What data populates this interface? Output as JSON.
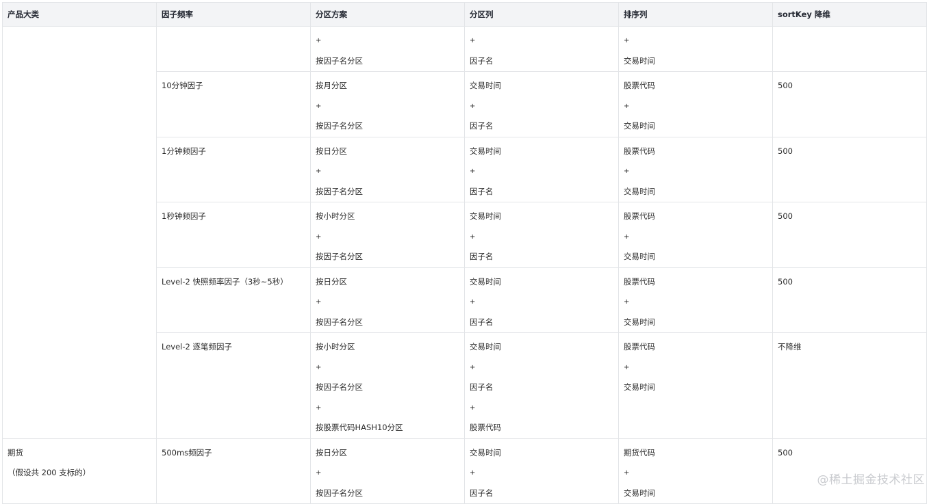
{
  "headers": [
    "产品大类",
    "因子频率",
    "分区方案",
    "分区列",
    "排序列",
    "sortKey 降维"
  ],
  "top_partial_row": {
    "scheme": [
      "+",
      "按因子名分区"
    ],
    "partcol": [
      "+",
      "因子名"
    ],
    "sortcol": [
      "+",
      "交易时间"
    ],
    "sortkey": ""
  },
  "rows": [
    {
      "freq": "10分钟因子",
      "scheme": [
        "按月分区",
        "+",
        " 按因子名分区"
      ],
      "partcol": [
        "交易时间",
        "+",
        " 因子名"
      ],
      "sortcol": [
        "股票代码",
        "+",
        "交易时间"
      ],
      "sortkey": "500"
    },
    {
      "freq": "1分钟频因子",
      "scheme": [
        "按日分区",
        "+",
        "按因子名分区"
      ],
      "partcol": [
        "交易时间",
        "+",
        " 因子名"
      ],
      "sortcol": [
        "股票代码",
        "+",
        "交易时间"
      ],
      "sortkey": "500"
    },
    {
      "freq": "1秒钟频因子",
      "scheme": [
        "按小时分区",
        "+",
        "按因子名分区"
      ],
      "partcol": [
        "交易时间",
        "+",
        "因子名"
      ],
      "sortcol": [
        "股票代码",
        "+",
        "交易时间"
      ],
      "sortkey": "500"
    },
    {
      "freq": "Level-2 快照频率因子（3秒~5秒）",
      "scheme": [
        "按日分区",
        "+",
        "按因子名分区"
      ],
      "partcol": [
        "交易时间",
        "+",
        " 因子名"
      ],
      "sortcol": [
        "股票代码",
        "+",
        "交易时间"
      ],
      "sortkey": "500"
    },
    {
      "freq": "Level-2 逐笔频因子",
      "scheme": [
        "按小时分区",
        "+",
        "按因子名分区",
        "+",
        "按股票代码HASH10分区"
      ],
      "partcol": [
        "交易时间",
        "+",
        "因子名",
        "+",
        "股票代码"
      ],
      "sortcol": [
        "股票代码",
        "+",
        "交易时间"
      ],
      "sortkey": "不降维"
    }
  ],
  "futures_row": {
    "category": [
      "期货",
      "（假设共 200 支标的）"
    ],
    "freq": "500ms频因子",
    "scheme": [
      "按日分区",
      "+",
      " 按因子名分区"
    ],
    "partcol": [
      "交易时间",
      "+",
      " 因子名"
    ],
    "sortcol": [
      "期货代码",
      "+",
      "交易时间"
    ],
    "sortkey": "500"
  },
  "watermark": "@稀土掘金技术社区"
}
